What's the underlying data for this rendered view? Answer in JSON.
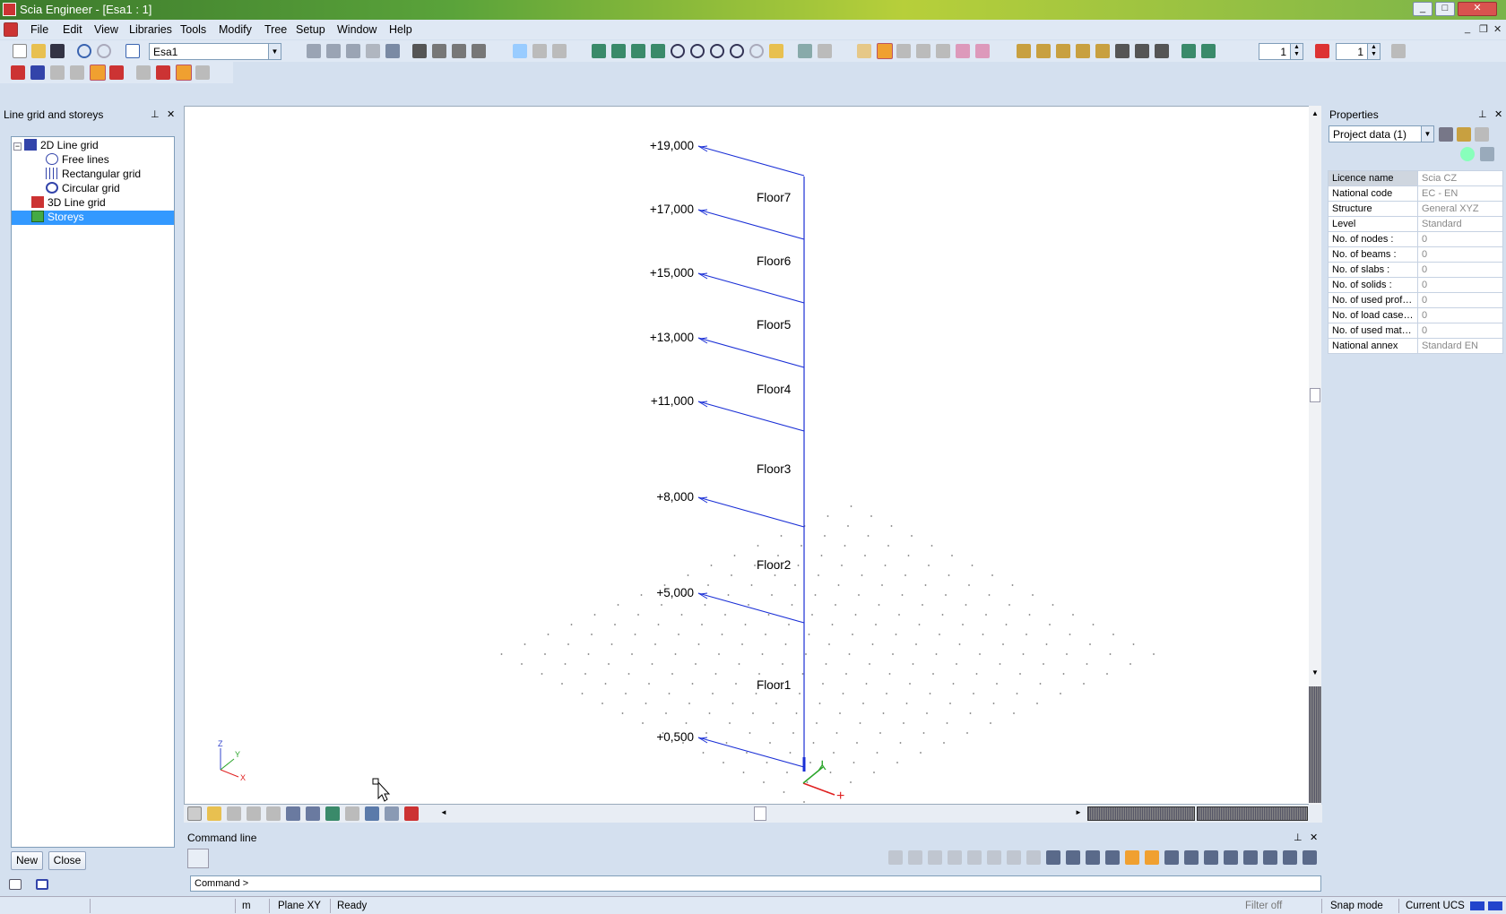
{
  "window": {
    "title": "Scia Engineer - [Esa1 : 1]"
  },
  "menu": [
    "File",
    "Edit",
    "View",
    "Libraries",
    "Tools",
    "Modify",
    "Tree",
    "Setup",
    "Window",
    "Help"
  ],
  "toolbar": {
    "project_combo": "Esa1",
    "spin1": "1",
    "spin2": "1"
  },
  "left_panel": {
    "title": "Line grid and storeys",
    "tree": [
      {
        "label": "2D Line grid",
        "level": 0,
        "expanded": true
      },
      {
        "label": "Free lines",
        "level": 1
      },
      {
        "label": "Rectangular grid",
        "level": 1
      },
      {
        "label": "Circular grid",
        "level": 1
      },
      {
        "label": "3D Line grid",
        "level": 0
      },
      {
        "label": "Storeys",
        "level": 0,
        "selected": true
      }
    ],
    "new_label": "New",
    "close_label": "Close"
  },
  "viewport": {
    "storey_levels": [
      "+19,000",
      "+17,000",
      "+15,000",
      "+13,000",
      "+11,000",
      "+8,000",
      "+5,000",
      "+0,500"
    ],
    "floor_labels": [
      "Floor7",
      "Floor6",
      "Floor5",
      "Floor4",
      "Floor3",
      "Floor2",
      "Floor1"
    ],
    "axis_labels": {
      "z": "Z",
      "y": "Y",
      "x": "X"
    }
  },
  "command_line": {
    "title": "Command line",
    "prompt": "Command >"
  },
  "properties": {
    "title": "Properties",
    "selector": "Project data (1)",
    "rows": [
      {
        "key": "Licence name",
        "value": "Scia CZ"
      },
      {
        "key": "National code",
        "value": "EC - EN"
      },
      {
        "key": "Structure",
        "value": "General XYZ"
      },
      {
        "key": "Level",
        "value": "Standard"
      },
      {
        "key": "No. of nodes :",
        "value": "0"
      },
      {
        "key": "No. of beams :",
        "value": "0"
      },
      {
        "key": "No. of slabs :",
        "value": "0"
      },
      {
        "key": "No. of solids :",
        "value": "0"
      },
      {
        "key": "No. of used profile...",
        "value": "0"
      },
      {
        "key": "No. of load cases :",
        "value": "0"
      },
      {
        "key": "No. of used materi...",
        "value": "0"
      },
      {
        "key": "National annex",
        "value": "Standard EN"
      }
    ]
  },
  "status": {
    "unit": "m",
    "plane": "Plane XY",
    "state": "Ready",
    "filter": "Filter off",
    "snap": "Snap mode",
    "ucs": "Current UCS"
  },
  "colors": {
    "storey_line": "#1a2fd6",
    "axis_x": "#e02020",
    "axis_y": "#2aa52a",
    "selection": "#3399ff"
  }
}
